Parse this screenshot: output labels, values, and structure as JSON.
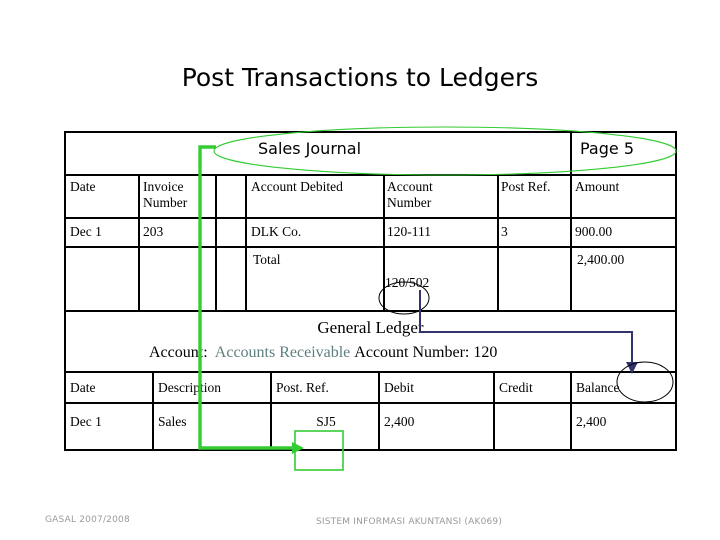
{
  "slide": {
    "title": "Post Transactions to Ledgers",
    "footer_left": "GASAL 2007/2008",
    "footer_center": "SISTEM INFORMASI AKUNTANSI (AK069)"
  },
  "sales_journal": {
    "heading": "Sales Journal",
    "page_label": "Page 5",
    "columns": [
      "Date",
      "Invoice\nNumber",
      "",
      "Account Debited",
      "Account\nNumber",
      "Post Ref.",
      "Amount"
    ],
    "rows": [
      {
        "date": "Dec 1",
        "invoice_number": "203",
        "spacer": "",
        "account_debited": "DLK Co.",
        "account_number": "120-111",
        "post_ref": "3",
        "amount": "900.00"
      },
      {
        "date": "",
        "invoice_number": "",
        "spacer": "",
        "account_debited": "Total",
        "account_number": "120/502",
        "post_ref": "",
        "amount": "2,400.00"
      }
    ]
  },
  "general_ledger": {
    "heading": "General Ledger",
    "account_label": "Account:",
    "account_name": "Accounts Receivable",
    "account_number_label": "Account Number: 120",
    "columns": [
      "Date",
      "Description",
      "Post. Ref.",
      "Debit",
      "Credit",
      "Balance"
    ],
    "rows": [
      {
        "date": "Dec 1",
        "description": "Sales",
        "post_ref": "SJ5",
        "debit": "2,400",
        "credit": "",
        "balance": "2,400"
      }
    ]
  },
  "annotations": {
    "green_color": "#33cc33",
    "navy_color": "#33336e",
    "black_color": "#000000",
    "green_oval_label": "sales-journal-highlight-oval",
    "green_arrow_label": "sales-journal-to-post-ref-arrow",
    "green_box_label": "post-ref-callout-box",
    "navy_arrow_label": "account-number-to-balance-arrow",
    "black_oval_account_number": "account-number-total-circle",
    "black_oval_balance": "balance-column-circle"
  }
}
